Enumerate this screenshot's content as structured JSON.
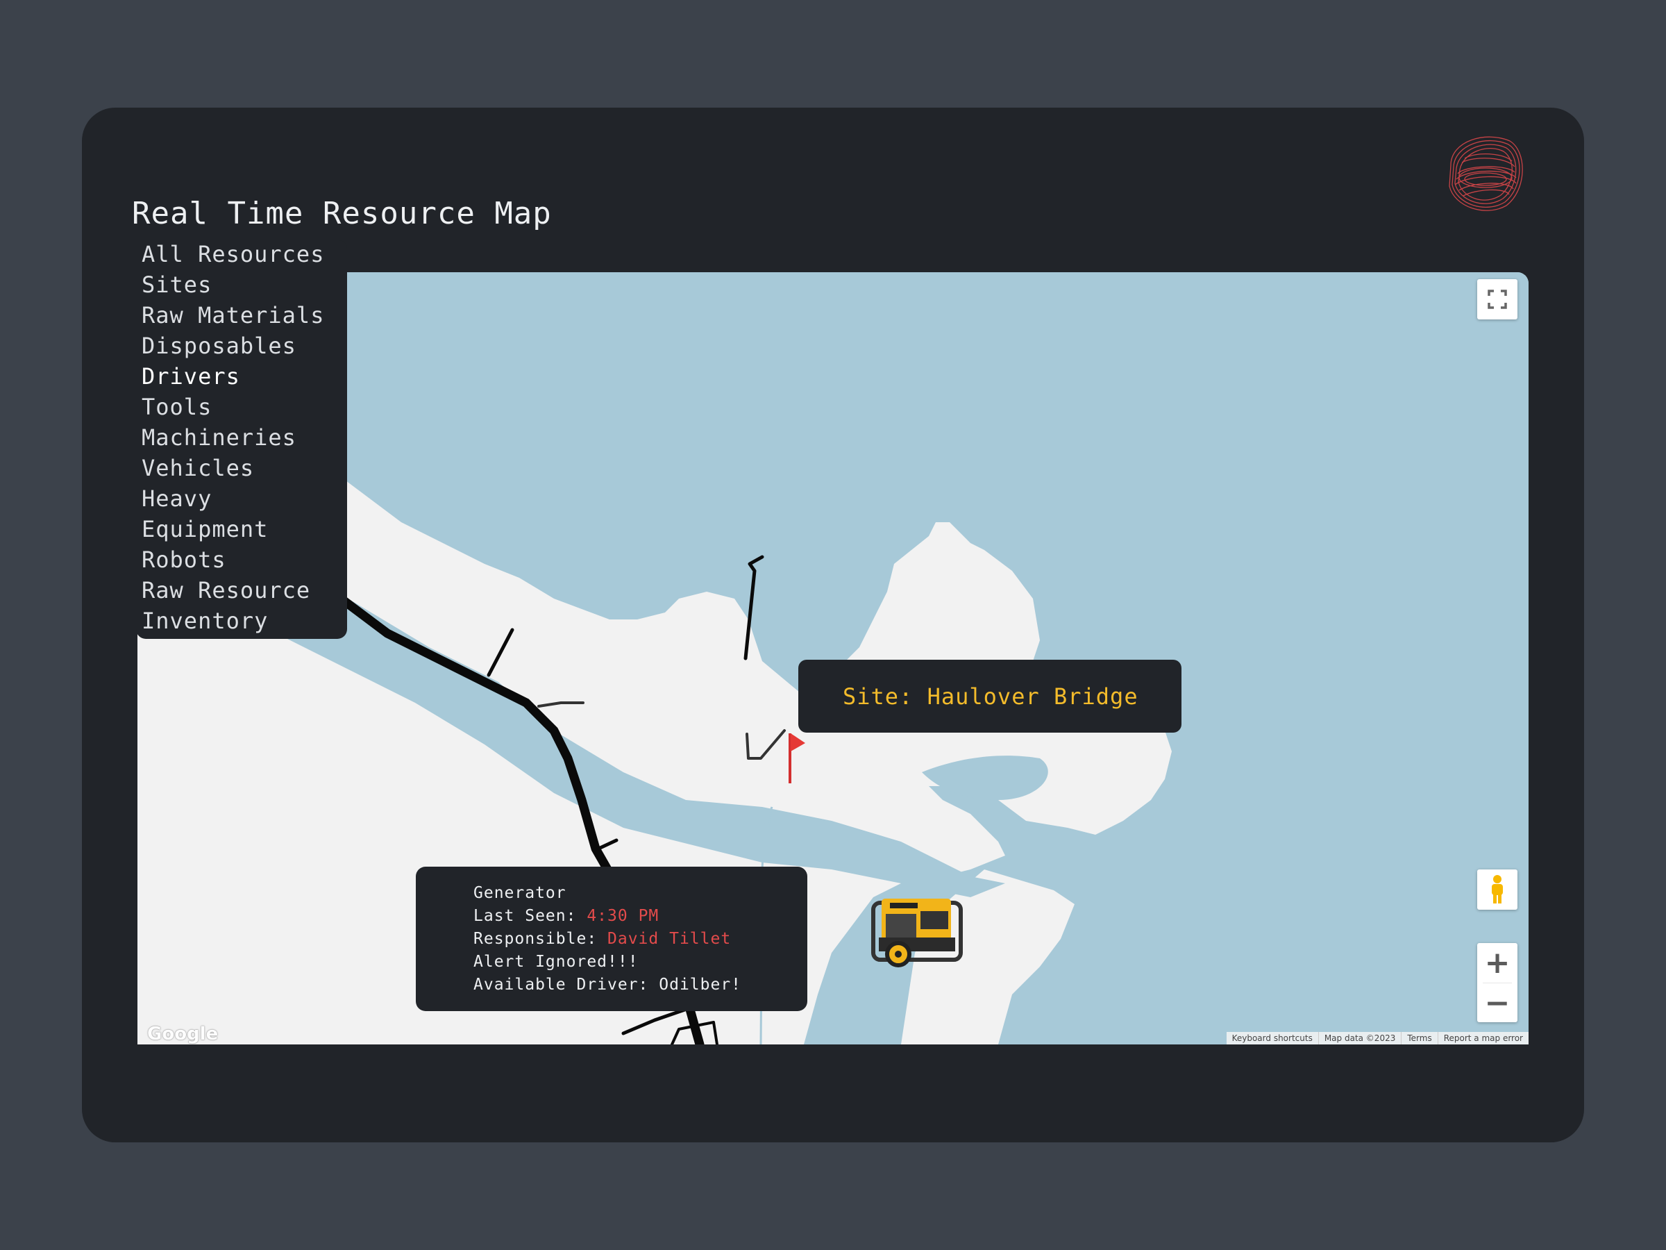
{
  "app": {
    "title": "Real Time Resource Map"
  },
  "menu": {
    "items": [
      {
        "label": "All Resources",
        "name": "menu-item-all-resources"
      },
      {
        "label": "Sites",
        "name": "menu-item-sites"
      },
      {
        "label": "Raw Materials",
        "name": "menu-item-raw-materials"
      },
      {
        "label": "Disposables",
        "name": "menu-item-disposables"
      },
      {
        "label": "Drivers",
        "name": "menu-item-drivers"
      },
      {
        "label": "Tools",
        "name": "menu-item-tools"
      },
      {
        "label": "Machineries",
        "name": "menu-item-machineries"
      },
      {
        "label": "Vehicles",
        "name": "menu-item-vehicles"
      },
      {
        "label": "Heavy",
        "name": "menu-item-heavy"
      },
      {
        "label": "Equipment",
        "name": "menu-item-equipment"
      },
      {
        "label": "Robots",
        "name": "menu-item-robots"
      },
      {
        "label": "Raw Resource",
        "name": "menu-item-raw-resource"
      },
      {
        "label": "Inventory",
        "name": "menu-item-inventory"
      }
    ],
    "active_label": "Drivers"
  },
  "site_label": {
    "text": "Site: Haulover Bridge"
  },
  "popup": {
    "resource": "Generator",
    "last_seen_label": "Last Seen: ",
    "last_seen_value": "4:30 PM",
    "responsible_label": "Responsible: ",
    "responsible_value": "David Tillet",
    "alert": "Alert Ignored!!!",
    "available_driver": "Available Driver: Odilber!"
  },
  "map": {
    "google_logo": "Google",
    "attribution": [
      "Keyboard shortcuts",
      "Map data ©2023",
      "Terms",
      "Report a map error"
    ],
    "zoom_in": "+",
    "zoom_out": "−",
    "icons": [
      "fullscreen-icon",
      "pegman-icon",
      "site-flag-icon",
      "generator-icon"
    ]
  },
  "colors": {
    "page_background": "#3c424b",
    "card_background": "#212429",
    "water": "#a7c9d8",
    "land": "#f2f2f2",
    "accent_yellow": "#f3bb2b",
    "alert_red": "#e24b4b",
    "muted_text": "#7e8a8c"
  }
}
